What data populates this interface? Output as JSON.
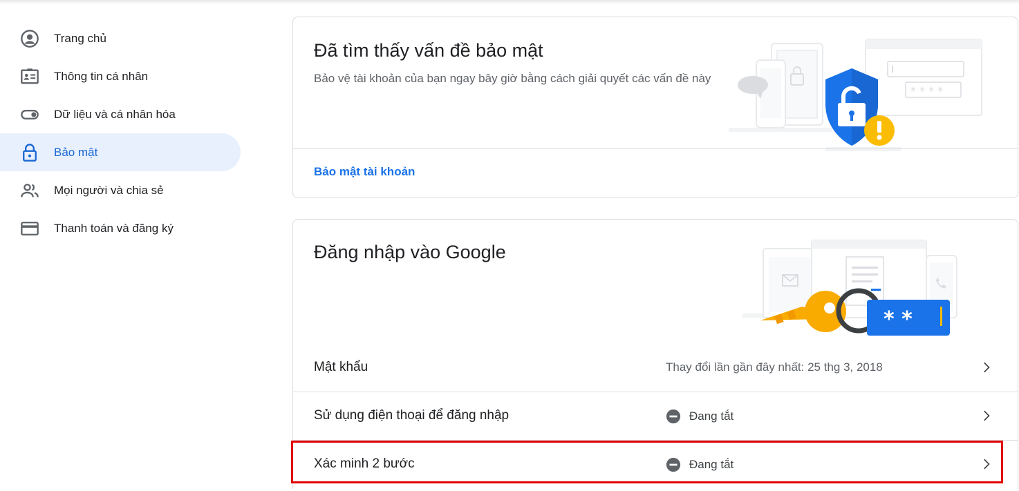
{
  "sidebar": {
    "items": [
      {
        "label": "Trang chủ",
        "icon": "account-circle-icon"
      },
      {
        "label": "Thông tin cá nhân",
        "icon": "id-card-icon"
      },
      {
        "label": "Dữ liệu và cá nhân hóa",
        "icon": "toggle-icon"
      },
      {
        "label": "Bảo mật",
        "icon": "lock-icon",
        "active": true
      },
      {
        "label": "Mọi người và chia sẻ",
        "icon": "people-icon"
      },
      {
        "label": "Thanh toán và đăng ký",
        "icon": "credit-card-icon"
      }
    ]
  },
  "security_issue_card": {
    "title": "Đã tìm thấy vấn đề bảo mật",
    "description": "Bảo vệ tài khoản của bạn ngay bây giờ bằng cách giải quyết các vấn đề này",
    "link": "Bảo mật tài khoản"
  },
  "signin_card": {
    "title": "Đăng nhập vào Google",
    "rows": [
      {
        "label": "Mật khẩu",
        "value": "Thay đổi lần gần đây nhất: 25 thg 3, 2018"
      },
      {
        "label": "Sử dụng điện thoại để đăng nhập",
        "value": "Đang tắt",
        "status": "off"
      },
      {
        "label": "Xác minh 2 bước",
        "value": "Đang tắt",
        "status": "off"
      }
    ]
  },
  "colors": {
    "accent": "#1a73e8",
    "active_bg": "#e8f0fe",
    "highlight": "#e00000",
    "shield": "#1a73e8",
    "warning": "#fbbc04",
    "key": "#f9ab00"
  }
}
